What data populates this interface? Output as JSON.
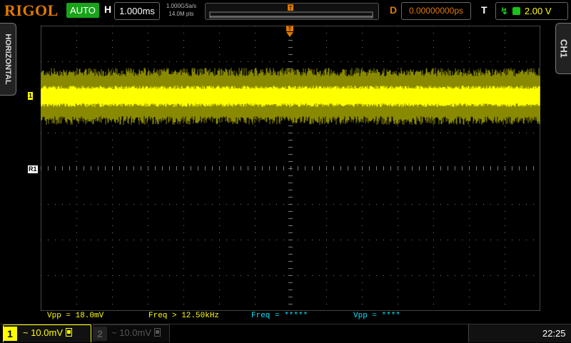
{
  "header": {
    "brand": "RIGOL",
    "run_mode": "AUTO",
    "horizontal_label": "H",
    "timebase": "1.000ms",
    "sample_rate": "1.000GSa/s",
    "memory_depth": "14.0M pts",
    "delay_label": "D",
    "delay_value": "0.00000000ps",
    "trigger_label": "T",
    "trigger_level": "2.00 V"
  },
  "side_tabs": {
    "left": "HORIZONTAL",
    "right": "CH1"
  },
  "markers": {
    "ch1": "1",
    "ref1": "R1",
    "trigger_pos": "T"
  },
  "measurements": [
    {
      "label": "Vpp = 18.0mV",
      "color": "#ffff00"
    },
    {
      "label": "Freq > 12.50kHz",
      "color": "#ffff00"
    },
    {
      "label": "Freq = *****",
      "color": "#00e5ff"
    },
    {
      "label": "Vpp = ****",
      "color": "#00e5ff"
    }
  ],
  "channels": [
    {
      "num": "1",
      "scale": "~ 10.0mV",
      "active": true,
      "color": "#ffff00"
    },
    {
      "num": "2",
      "scale": "~ 10.0mV",
      "active": false,
      "color": "#555555"
    }
  ],
  "clock": "22:25",
  "colors": {
    "trace": "#ffff00",
    "trace_noise": "#8a8a00",
    "grid": "#7a7a7a",
    "accent": "#e07a00",
    "auto_green": "#19a319"
  }
}
